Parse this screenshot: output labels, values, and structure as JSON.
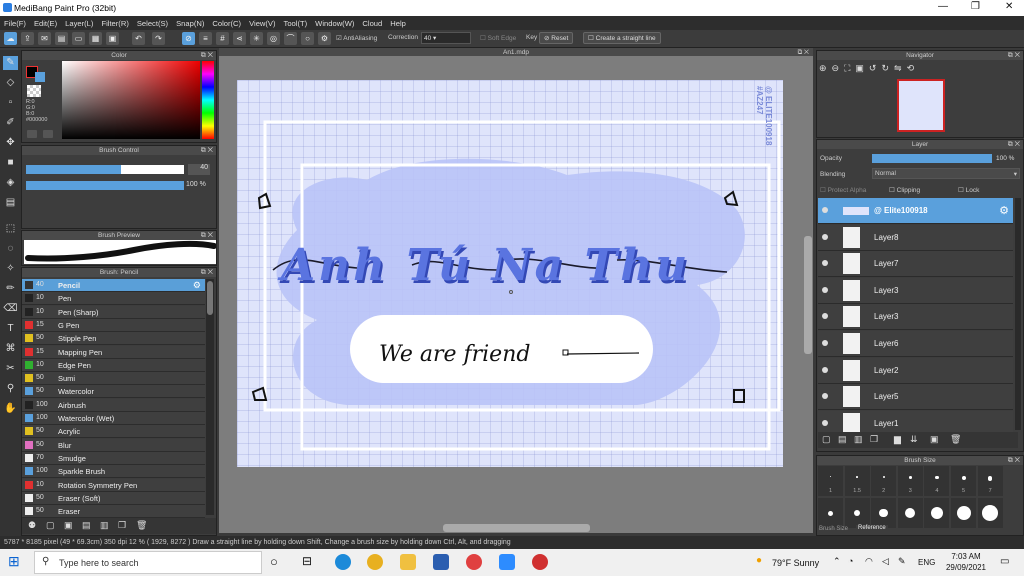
{
  "window": {
    "title": "MediBang Paint Pro (32bit)"
  },
  "menu": [
    "File(F)",
    "Edit(E)",
    "Layer(L)",
    "Filter(R)",
    "Select(S)",
    "Snap(N)",
    "Color(C)",
    "View(V)",
    "Tool(T)",
    "Window(W)",
    "Cloud",
    "Help"
  ],
  "toolbar": {
    "antialiasing": "AntiAliasing",
    "correction_label": "Correction",
    "correction_value": "40",
    "soft_edge": "Soft Edge",
    "key_label": "Key",
    "reset": "Reset",
    "straight_line": "Create a straight line"
  },
  "color_panel": {
    "title": "Color",
    "r": "R:0",
    "g": "G:0",
    "b": "B:0",
    "hex": "#000000",
    "accent": "#5aa0dc"
  },
  "brush_control": {
    "title": "Brush Control",
    "size": "40",
    "opacity": "100 %",
    "size_fraction": 0.6,
    "opacity_fraction": 1.0
  },
  "brush_preview": {
    "title": "Brush Preview"
  },
  "brush_list": {
    "title": "Brush: Pencil",
    "items": [
      {
        "size": "40",
        "name": "Pencil",
        "color": "#333333"
      },
      {
        "size": "10",
        "name": "Pen",
        "color": "#222222"
      },
      {
        "size": "10",
        "name": "Pen (Sharp)",
        "color": "#222222"
      },
      {
        "size": "15",
        "name": "G Pen",
        "color": "#e03030"
      },
      {
        "size": "50",
        "name": "Stipple Pen",
        "color": "#e0c020"
      },
      {
        "size": "15",
        "name": "Mapping Pen",
        "color": "#e03030"
      },
      {
        "size": "10",
        "name": "Edge Pen",
        "color": "#30b030"
      },
      {
        "size": "50",
        "name": "Sumi",
        "color": "#e0c020"
      },
      {
        "size": "50",
        "name": "Watercolor",
        "color": "#5aa0dc"
      },
      {
        "size": "100",
        "name": "Airbrush",
        "color": "#222222"
      },
      {
        "size": "100",
        "name": "Watercolor (Wet)",
        "color": "#5aa0dc"
      },
      {
        "size": "50",
        "name": "Acrylic",
        "color": "#e0c020"
      },
      {
        "size": "50",
        "name": "Blur",
        "color": "#e070c0"
      },
      {
        "size": "70",
        "name": "Smudge",
        "color": "#eeeeee"
      },
      {
        "size": "100",
        "name": "Sparkle Brush",
        "color": "#5aa0dc"
      },
      {
        "size": "10",
        "name": "Rotation Symmetry Pen",
        "color": "#e03030"
      },
      {
        "size": "50",
        "name": "Eraser (Soft)",
        "color": "#eeeeee"
      },
      {
        "size": "50",
        "name": "Eraser",
        "color": "#eeeeee"
      }
    ]
  },
  "canvas": {
    "tab": "An1.mdp",
    "title_text": "Anh Tú Na Thu",
    "subtitle_text": "We are friend",
    "watermark": "@ ELITE100918 #AZ247"
  },
  "navigator": {
    "title": "Navigator"
  },
  "layer_panel": {
    "title": "Layer",
    "opacity_label": "Opacity",
    "opacity_value": "100 %",
    "blending_label": "Blending",
    "blending_value": "Normal",
    "protect_alpha": "Protect Alpha",
    "clipping": "Clipping",
    "lock": "Lock",
    "layers": [
      {
        "name": "@ Elite100918",
        "selected": true
      },
      {
        "name": "Layer8"
      },
      {
        "name": "Layer7"
      },
      {
        "name": "Layer3"
      },
      {
        "name": "Layer3"
      },
      {
        "name": "Layer6"
      },
      {
        "name": "Layer2"
      },
      {
        "name": "Layer5"
      },
      {
        "name": "Layer1"
      }
    ]
  },
  "brush_size_panel": {
    "title": "Brush Size",
    "labels": [
      "1",
      "1.5",
      "2",
      "3",
      "4",
      "5",
      "7"
    ],
    "tabs": [
      "Brush Size",
      "Reference"
    ]
  },
  "status": {
    "text": "5787 * 8185 pixel   (49 * 69.3cm)   350 dpi   12 %   ( 1929, 8272 )   Draw a straight line by holding down Shift, Change a brush size by holding down Ctrl, Alt, and dragging"
  },
  "taskbar": {
    "search_placeholder": "Type here to search",
    "weather": "79°F  Sunny",
    "lang": "ENG",
    "time": "7:03 AM",
    "date": "29/09/2021"
  }
}
